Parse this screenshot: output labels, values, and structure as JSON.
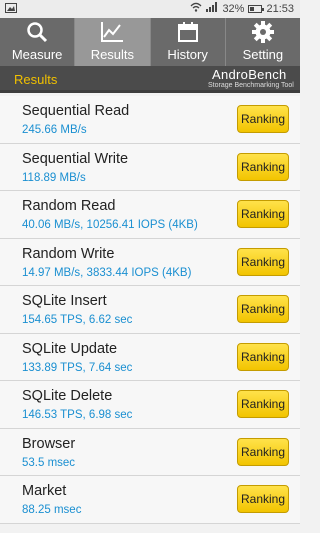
{
  "status_bar": {
    "battery_percent": "32%",
    "battery_level": 0.32,
    "time": "21:53"
  },
  "tabs": [
    {
      "label": "Measure",
      "icon": "search-icon",
      "active": false
    },
    {
      "label": "Results",
      "icon": "chart-icon",
      "active": true
    },
    {
      "label": "History",
      "icon": "calendar-icon",
      "active": false
    },
    {
      "label": "Setting",
      "icon": "gear-icon",
      "active": false
    }
  ],
  "subheader": {
    "title": "Results",
    "logo_brand": "AndroBench",
    "logo_tagline": "Storage Benchmarking Tool"
  },
  "results": [
    {
      "name": "Sequential Read",
      "value": "245.66 MB/s",
      "button": "Ranking"
    },
    {
      "name": "Sequential Write",
      "value": "118.89 MB/s",
      "button": "Ranking"
    },
    {
      "name": "Random Read",
      "value": "40.06 MB/s, 10256.41 IOPS (4KB)",
      "button": "Ranking"
    },
    {
      "name": "Random Write",
      "value": "14.97 MB/s, 3833.44 IOPS (4KB)",
      "button": "Ranking"
    },
    {
      "name": "SQLite Insert",
      "value": "154.65 TPS, 6.62 sec",
      "button": "Ranking"
    },
    {
      "name": "SQLite Update",
      "value": "133.89 TPS, 7.64 sec",
      "button": "Ranking"
    },
    {
      "name": "SQLite Delete",
      "value": "146.53 TPS, 6.98 sec",
      "button": "Ranking"
    },
    {
      "name": "Browser",
      "value": "53.5 msec",
      "button": "Ranking"
    },
    {
      "name": "Market",
      "value": "88.25 msec",
      "button": "Ranking"
    }
  ]
}
